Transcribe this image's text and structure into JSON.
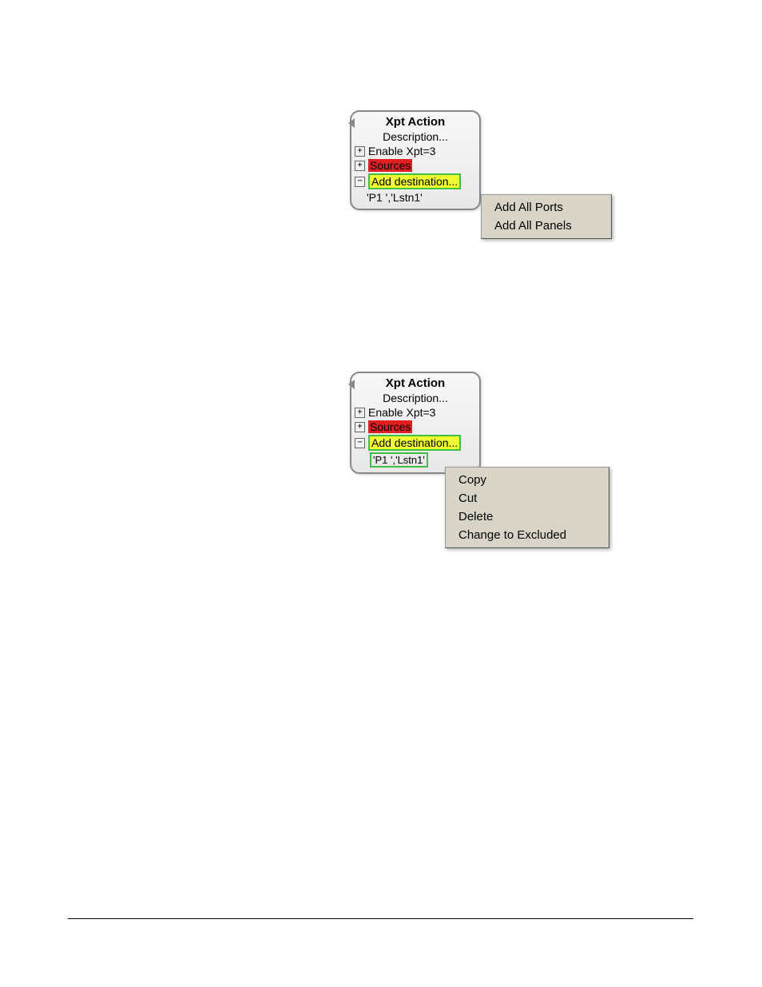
{
  "panel1": {
    "title": "Xpt Action",
    "description": "Description...",
    "enable": "Enable Xpt=3",
    "sources": "Sources",
    "add_dest": "Add destination...",
    "leaf": "'P1   ','Lstn1'"
  },
  "menu1": {
    "items": [
      "Add All Ports",
      "Add All Panels"
    ]
  },
  "panel2": {
    "title": "Xpt Action",
    "description": "Description...",
    "enable": "Enable Xpt=3",
    "sources": "Sources",
    "add_dest": "Add destination...",
    "leaf": "'P1   ','Lstn1'"
  },
  "menu2": {
    "items": [
      "Copy",
      "Cut",
      "Delete",
      "Change to Excluded"
    ]
  }
}
